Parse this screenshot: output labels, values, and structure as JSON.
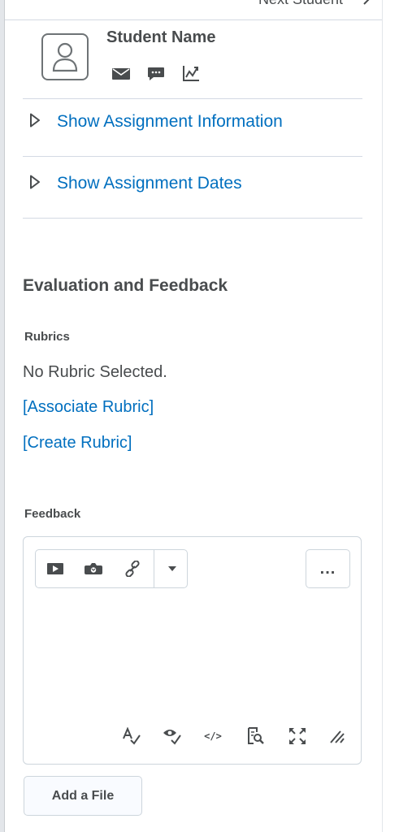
{
  "header": {
    "next_student_label": "Next Student",
    "next_icon": "chevron-right-icon"
  },
  "student": {
    "name": "Student Name",
    "avatar_icon": "user-avatar-icon",
    "actions": [
      "email-icon",
      "message-icon",
      "progress-chart-icon"
    ]
  },
  "toggles": [
    {
      "label": "Show Assignment Information",
      "icon": "expand-triangle-icon"
    },
    {
      "label": "Show Assignment Dates",
      "icon": "expand-triangle-icon"
    }
  ],
  "evaluation": {
    "title": "Evaluation and Feedback",
    "rubrics": {
      "label": "Rubrics",
      "status": "No Rubric Selected.",
      "associate_link": "[Associate Rubric]",
      "create_link": "[Create Rubric]"
    },
    "feedback": {
      "label": "Feedback",
      "toolbar_icons": [
        "video-icon",
        "camera-icon",
        "link-icon",
        "dropdown-arrow-icon"
      ],
      "more_label": "...",
      "bottom_icons": [
        "spellcheck-icon",
        "accessibility-check-icon",
        "source-code-icon",
        "preview-icon",
        "fullscreen-icon",
        "resize-handle-icon"
      ],
      "source_code_glyph": "</>"
    },
    "add_file_label": "Add a File"
  },
  "colors": {
    "link": "#006fbf",
    "text": "#494c4e",
    "border": "#cdd5dc"
  }
}
